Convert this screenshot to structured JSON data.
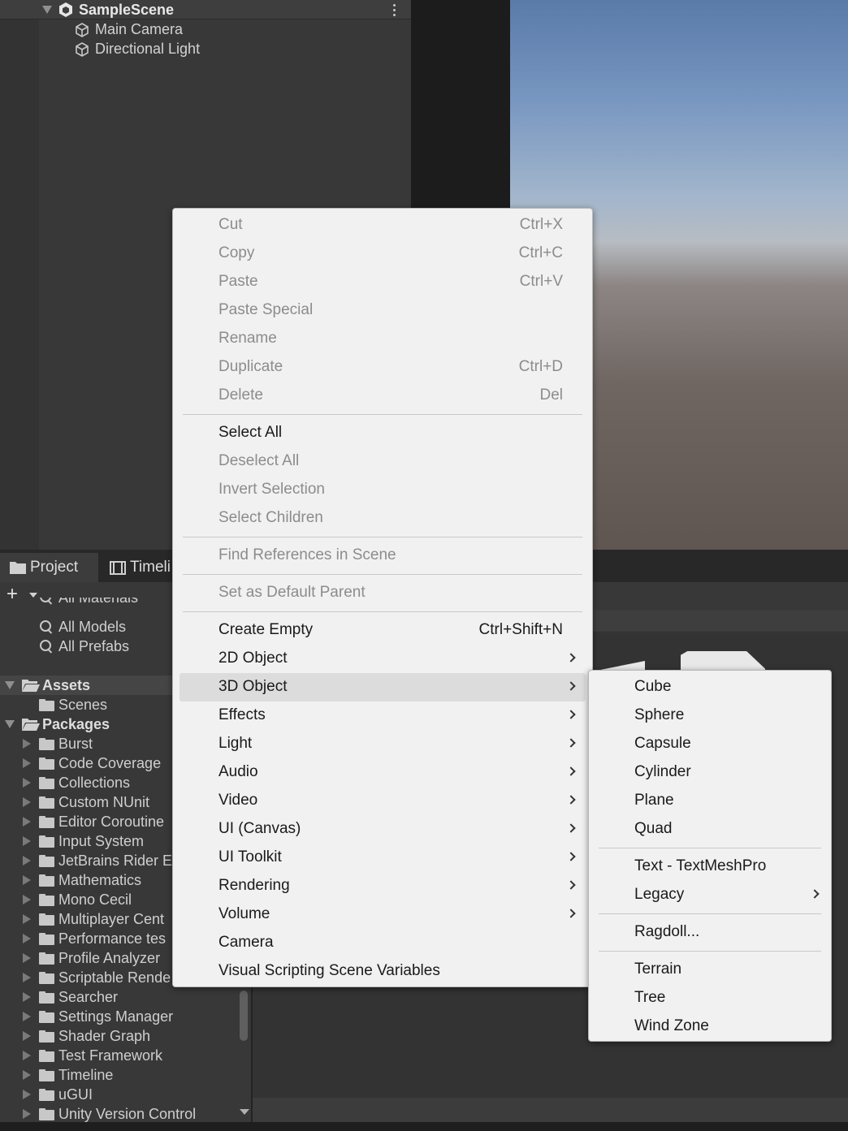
{
  "hierarchy": {
    "scene_name": "SampleScene",
    "items": [
      "Main Camera",
      "Directional Light"
    ]
  },
  "project": {
    "tabs": [
      "Project",
      "Timeli"
    ],
    "add_label": "+",
    "favorites": [
      "All Materials",
      "All Models",
      "All Prefabs"
    ],
    "assets_label": "Assets",
    "assets_children": [
      "Scenes"
    ],
    "packages_label": "Packages",
    "packages": [
      "Burst",
      "Code Coverage",
      "Collections",
      "Custom NUnit",
      "Editor Coroutine",
      "Input System",
      "JetBrains Rider E",
      "Mathematics",
      "Mono Cecil",
      "Multiplayer Cent",
      "Performance tes",
      "Profile Analyzer",
      "Scriptable Rende",
      "Searcher",
      "Settings Manager",
      "Shader Graph",
      "Test Framework",
      "Timeline",
      "uGUI",
      "Unity Version Control"
    ]
  },
  "context_menu": {
    "items": [
      {
        "label": "Cut",
        "shortcut": "Ctrl+X",
        "disabled": true
      },
      {
        "label": "Copy",
        "shortcut": "Ctrl+C",
        "disabled": true
      },
      {
        "label": "Paste",
        "shortcut": "Ctrl+V",
        "disabled": true
      },
      {
        "label": "Paste Special",
        "shortcut": "",
        "disabled": true
      },
      {
        "label": "Rename",
        "shortcut": "",
        "disabled": true
      },
      {
        "label": "Duplicate",
        "shortcut": "Ctrl+D",
        "disabled": true
      },
      {
        "label": "Delete",
        "shortcut": "Del",
        "disabled": true
      },
      {
        "label": "Select All",
        "shortcut": "",
        "disabled": false
      },
      {
        "label": "Deselect All",
        "shortcut": "",
        "disabled": true
      },
      {
        "label": "Invert Selection",
        "shortcut": "",
        "disabled": true
      },
      {
        "label": "Select Children",
        "shortcut": "",
        "disabled": true
      },
      {
        "label": "Find References in Scene",
        "shortcut": "",
        "disabled": true
      },
      {
        "label": "Set as Default Parent",
        "shortcut": "",
        "disabled": true
      },
      {
        "label": "Create Empty",
        "shortcut": "Ctrl+Shift+N",
        "disabled": false
      },
      {
        "label": "2D Object",
        "shortcut": "",
        "disabled": false,
        "submenu": true
      },
      {
        "label": "3D Object",
        "shortcut": "",
        "disabled": false,
        "submenu": true,
        "highlighted": true
      },
      {
        "label": "Effects",
        "shortcut": "",
        "disabled": false,
        "submenu": true
      },
      {
        "label": "Light",
        "shortcut": "",
        "disabled": false,
        "submenu": true
      },
      {
        "label": "Audio",
        "shortcut": "",
        "disabled": false,
        "submenu": true
      },
      {
        "label": "Video",
        "shortcut": "",
        "disabled": false,
        "submenu": true
      },
      {
        "label": "UI (Canvas)",
        "shortcut": "",
        "disabled": false,
        "submenu": true
      },
      {
        "label": "UI Toolkit",
        "shortcut": "",
        "disabled": false,
        "submenu": true
      },
      {
        "label": "Rendering",
        "shortcut": "",
        "disabled": false,
        "submenu": true
      },
      {
        "label": "Volume",
        "shortcut": "",
        "disabled": false,
        "submenu": true
      },
      {
        "label": "Camera",
        "shortcut": "",
        "disabled": false
      },
      {
        "label": "Visual Scripting Scene Variables",
        "shortcut": "",
        "disabled": false
      }
    ]
  },
  "submenu_3d": {
    "items": [
      {
        "label": "Cube"
      },
      {
        "label": "Sphere"
      },
      {
        "label": "Capsule"
      },
      {
        "label": "Cylinder"
      },
      {
        "label": "Plane"
      },
      {
        "label": "Quad"
      },
      {
        "label": "Text - TextMeshPro"
      },
      {
        "label": "Legacy",
        "submenu": true
      },
      {
        "label": "Ragdoll..."
      },
      {
        "label": "Terrain"
      },
      {
        "label": "Tree"
      },
      {
        "label": "Wind Zone"
      }
    ]
  },
  "icons": {
    "scene": "unity-scene-icon",
    "gameobject": "cube-outline-icon",
    "folder": "folder-icon",
    "search": "search-icon",
    "timeline": "film-icon"
  }
}
